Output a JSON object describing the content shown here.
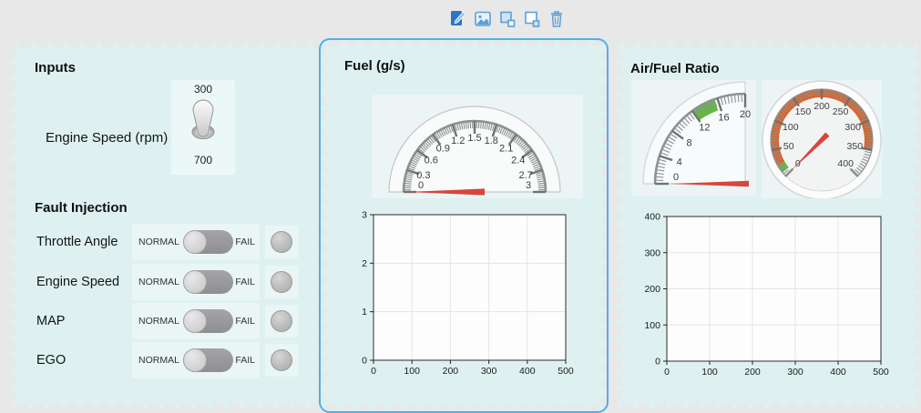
{
  "toolbar": {
    "icons": [
      {
        "name": "edit-panel"
      },
      {
        "name": "background-image"
      },
      {
        "name": "send-to-back"
      },
      {
        "name": "bring-to-front"
      },
      {
        "name": "delete-panel"
      }
    ]
  },
  "colors": {
    "selection": "#54aee3",
    "panel_background": "#def1f0",
    "needle_red": "#d6463c",
    "band_green": "#62ba3f",
    "band_orange": "#d9652c",
    "toolbar_icon_blue": "#5d9fd4",
    "toolbar_icon_fill": "#2d74c4"
  },
  "inputs_panel": {
    "title": "Inputs",
    "engine_speed_switch": {
      "label": "Engine Speed (rpm)",
      "top_label": "300",
      "bottom_label": "700",
      "selected": "300"
    },
    "fault_injection": {
      "title": "Fault Injection",
      "rows": [
        {
          "label": "Throttle Angle",
          "off_label": "NORMAL",
          "on_label": "FAIL",
          "state": "NORMAL"
        },
        {
          "label": "Engine Speed",
          "off_label": "NORMAL",
          "on_label": "FAIL",
          "state": "NORMAL"
        },
        {
          "label": "MAP",
          "off_label": "NORMAL",
          "on_label": "FAIL",
          "state": "NORMAL"
        },
        {
          "label": "EGO",
          "off_label": "NORMAL",
          "on_label": "FAIL",
          "state": "NORMAL"
        }
      ]
    }
  },
  "fuel_panel": {
    "title": "Fuel (g/s)",
    "gauge": {
      "type": "semicircular",
      "min": 0,
      "max": 3,
      "value": 0,
      "major_step": 0.3,
      "minor_step": 0.03,
      "labels": [
        "0",
        "0.3",
        "0.6",
        "0.9",
        "1.2",
        "1.5",
        "1.8",
        "2.1",
        "2.4",
        "2.7",
        "3"
      ],
      "bands": [],
      "needle_color": "#d6463c"
    },
    "plot": {
      "type": "line",
      "xlim": [
        0,
        500
      ],
      "ylim": [
        0,
        3
      ],
      "x_ticks": [
        0,
        100,
        200,
        300,
        400,
        500
      ],
      "y_ticks": [
        0,
        1,
        2,
        3
      ],
      "grid": true,
      "series": []
    }
  },
  "air_fuel_panel": {
    "title": "Air/Fuel Ratio",
    "quarter_gauge": {
      "type": "quarter",
      "min": 0,
      "max": 20,
      "value": 0,
      "major_step": 4,
      "minor_step": 0.5,
      "labels": [
        "0",
        "4",
        "8",
        "12",
        "16",
        "20"
      ],
      "bands": [
        {
          "color": "#62ba3f",
          "from": 12,
          "to": 15.5
        }
      ],
      "needle_color": "#d6463c"
    },
    "circular_gauge": {
      "type": "circular",
      "min": 0,
      "max": 400,
      "value": 0,
      "major_step": 50,
      "minor_step": 5,
      "labels": [
        "0",
        "50",
        "100",
        "150",
        "200",
        "250",
        "300",
        "350",
        "400"
      ],
      "bands": [
        {
          "color": "#62ba3f",
          "from": 8,
          "to": 22
        },
        {
          "color": "#d9652c",
          "from": 22,
          "to": 352
        }
      ],
      "needle_color": "#d6463c"
    },
    "plot": {
      "type": "line",
      "xlim": [
        0,
        500
      ],
      "ylim": [
        0,
        400
      ],
      "x_ticks": [
        0,
        100,
        200,
        300,
        400,
        500
      ],
      "y_ticks": [
        0,
        100,
        200,
        300,
        400
      ],
      "grid": true,
      "series": []
    }
  }
}
